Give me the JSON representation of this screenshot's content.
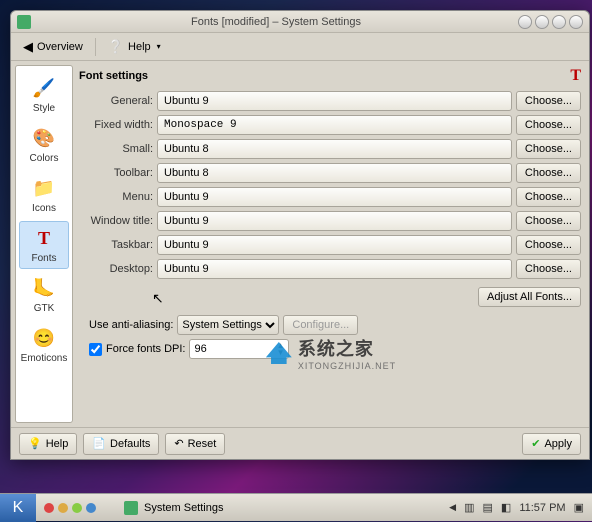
{
  "window": {
    "title": "Fonts [modified] – System Settings"
  },
  "toolbar": {
    "overview": "Overview",
    "help": "Help"
  },
  "sidebar": {
    "items": [
      {
        "label": "Style"
      },
      {
        "label": "Colors"
      },
      {
        "label": "Icons"
      },
      {
        "label": "Fonts"
      },
      {
        "label": "GTK"
      },
      {
        "label": "Emoticons"
      }
    ]
  },
  "panel": {
    "title": "Font settings",
    "rows": [
      {
        "label": "General:",
        "value": "Ubuntu 9",
        "choose": "Choose..."
      },
      {
        "label": "Fixed width:",
        "value": "Monospace  9",
        "choose": "Choose..."
      },
      {
        "label": "Small:",
        "value": "Ubuntu 8",
        "choose": "Choose..."
      },
      {
        "label": "Toolbar:",
        "value": "Ubuntu 8",
        "choose": "Choose..."
      },
      {
        "label": "Menu:",
        "value": "Ubuntu 9",
        "choose": "Choose..."
      },
      {
        "label": "Window title:",
        "value": "Ubuntu 9",
        "choose": "Choose..."
      },
      {
        "label": "Taskbar:",
        "value": "Ubuntu 9",
        "choose": "Choose..."
      },
      {
        "label": "Desktop:",
        "value": "Ubuntu 9",
        "choose": "Choose..."
      }
    ],
    "adjust_all": "Adjust All Fonts...",
    "aa_label": "Use anti-aliasing:",
    "aa_value": "System Settings",
    "aa_configure": "Configure...",
    "dpi_label": "Force fonts DPI:",
    "dpi_value": "96"
  },
  "footer": {
    "help": "Help",
    "defaults": "Defaults",
    "reset": "Reset",
    "apply": "Apply"
  },
  "taskbar": {
    "task": "System Settings",
    "time": "11:57 PM"
  },
  "watermark": {
    "cn": "系统之家",
    "en": "XITONGZHIJIA.NET"
  }
}
